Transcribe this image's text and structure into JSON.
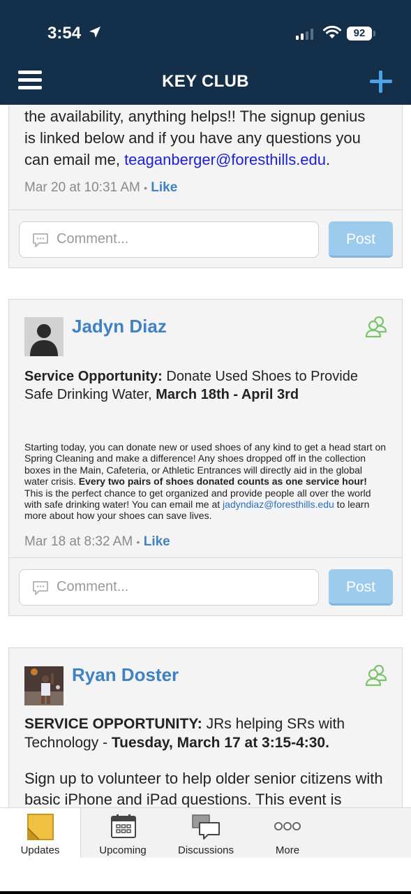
{
  "status": {
    "time": "3:54",
    "battery": "92"
  },
  "nav": {
    "title": "KEY CLUB"
  },
  "post1": {
    "text_lines": [
      "the availability, anything helps!! The signup genius",
      "is linked below and if you have any questions you",
      "can email me, "
    ],
    "email": "teaganberger@foresthills.edu",
    "after_email": ".",
    "date": "Mar 20 at 10:31 AM",
    "sep": "•",
    "like": "Like",
    "comment_placeholder": "Comment...",
    "post_label": "Post"
  },
  "post2": {
    "author": "Jadyn Diaz",
    "title_bold": "Service Opportunity:",
    "title_rest": " Donate Used Shoes to Provide Safe Drinking Water, ",
    "title_dates": "March 18th - April 3rd",
    "body_1": "Starting today, you can donate new or used shoes of any kind to get a head start on Spring Cleaning and make a difference! Any shoes dropped off in the collection boxes in the Main, Cafeteria, or Athletic Entrances will directly aid in the global water crisis. ",
    "body_bold": "Every two pairs of shoes donated counts as one service hour!",
    "body_2": " This is the perfect chance to get organized and provide people all over the world with safe drinking water! You can email me at ",
    "email": "jadyndiaz@foresthills.edu",
    "body_3": " to learn more about how your shoes can save lives.",
    "date": "Mar 18 at 8:32 AM",
    "sep": "•",
    "like": "Like",
    "comment_placeholder": "Comment...",
    "post_label": "Post"
  },
  "post3": {
    "author": "Ryan Doster",
    "title_bold": "SERVICE OPPORTUNITY:",
    "title_rest": " JRs helping SRs with Technology - ",
    "title_date": "Tuesday, March 17 at 3:15-4:30.",
    "body": "Sign up to volunteer to help older senior citizens with basic iPhone and iPad questions. This event is"
  },
  "tabs": [
    {
      "label": "Updates",
      "icon": "sticky-note-icon"
    },
    {
      "label": "Upcoming",
      "icon": "calendar-icon"
    },
    {
      "label": "Discussions",
      "icon": "chat-bubbles-icon"
    },
    {
      "label": "More",
      "icon": "more-dots-icon"
    }
  ]
}
